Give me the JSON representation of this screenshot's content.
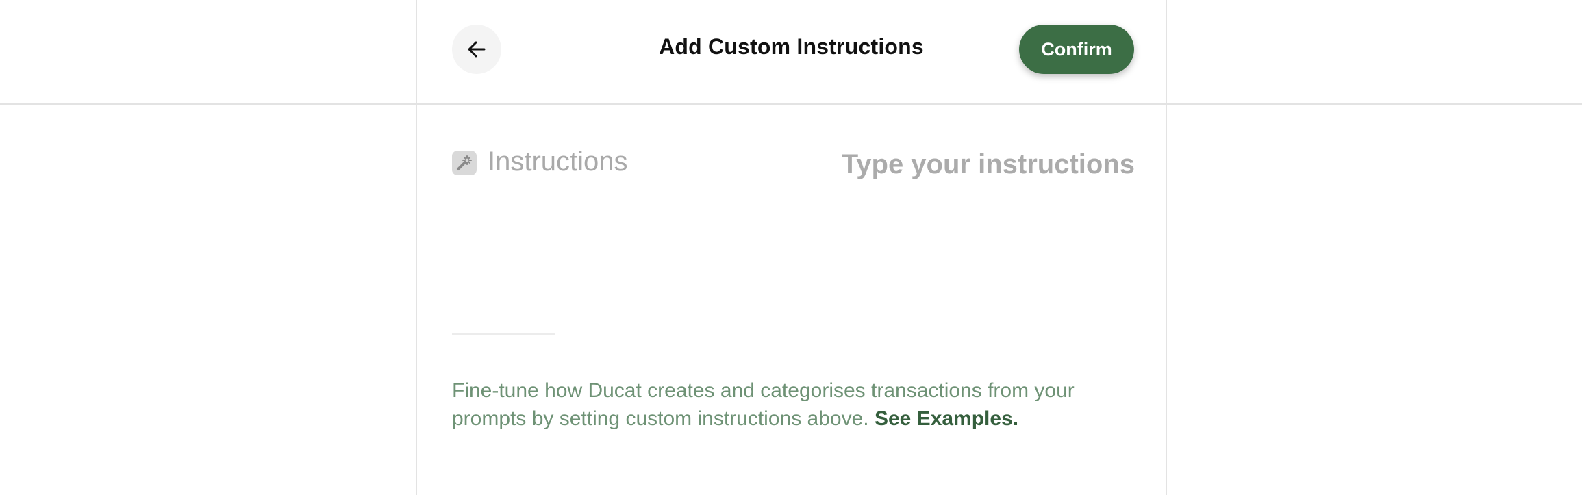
{
  "header": {
    "title": "Add Custom Instructions",
    "back_icon": "arrow-left-icon",
    "confirm_label": "Confirm"
  },
  "field": {
    "icon": "magic-wand-icon",
    "label": "Instructions",
    "value": "",
    "placeholder": "Type your instructions"
  },
  "help": {
    "text": "Fine-tune how Ducat creates and categorises transactions from your prompts by setting custom instructions above.",
    "link_label": "See Examples."
  },
  "colors": {
    "accent": "#3c6e45",
    "help_text": "#6e9275",
    "link": "#355f3d"
  }
}
